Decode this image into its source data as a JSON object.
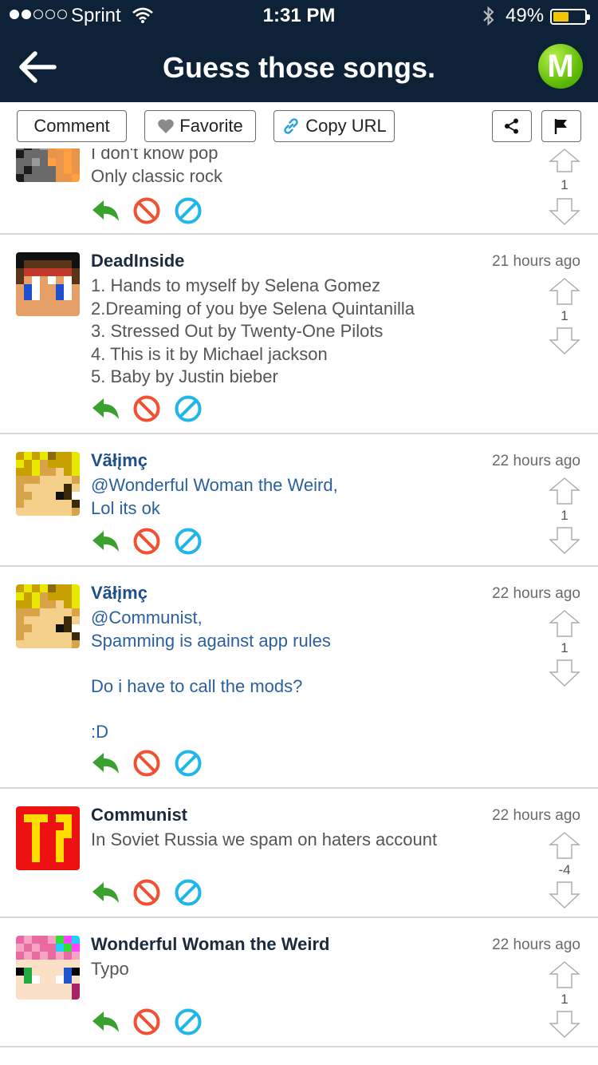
{
  "status_bar": {
    "carrier": "Sprint",
    "time": "1:31 PM",
    "battery_percent": "49%",
    "battery_level": 0.49
  },
  "nav": {
    "title": "Guess those songs.",
    "logo_letter": "M"
  },
  "actions": {
    "comment_label": "Comment",
    "favorite_label": "Favorite",
    "copy_url_label": "Copy URL"
  },
  "comments": [
    {
      "author": "",
      "time": "",
      "body": "I don't know pop\nOnly classic rock",
      "score": "1"
    },
    {
      "author": "DeadInside",
      "time": "21 hours ago",
      "body": "1. Hands to myself by Selena Gomez\n2.Dreaming of you bye Selena Quintanilla\n3. Stressed Out by Twenty-One Pilots\n4. This is it by Michael jackson\n5. Baby by Justin bieber",
      "score": "1"
    },
    {
      "author": "Vãłįmç",
      "time": "22 hours ago",
      "body": "@Wonderful Woman the Weird,\nLol its ok",
      "score": "1"
    },
    {
      "author": "Vãłįmç",
      "time": "22 hours ago",
      "body": "@Communist,\nSpamming is against app rules\n\nDo i have to call the mods?\n\n:D",
      "score": "1"
    },
    {
      "author": "Communist",
      "time": "22 hours ago",
      "body": "In Soviet Russia we spam on haters account",
      "score": "-4"
    },
    {
      "author": "Wonderful Woman the Weird",
      "time": "22 hours ago",
      "body": "Typo",
      "score": "1"
    }
  ],
  "colors": {
    "header_bg": "#0d2236",
    "reply_green": "#3aa02e",
    "block_red": "#ef5132",
    "hide_blue": "#1fb6ea",
    "mention_blue": "#2a5fa0"
  },
  "icons": [
    "back-arrow-icon",
    "brand-logo",
    "heart-icon",
    "link-icon",
    "share-icon",
    "flag-icon",
    "reply-icon",
    "block-icon",
    "hide-icon",
    "upvote-icon",
    "downvote-icon"
  ]
}
